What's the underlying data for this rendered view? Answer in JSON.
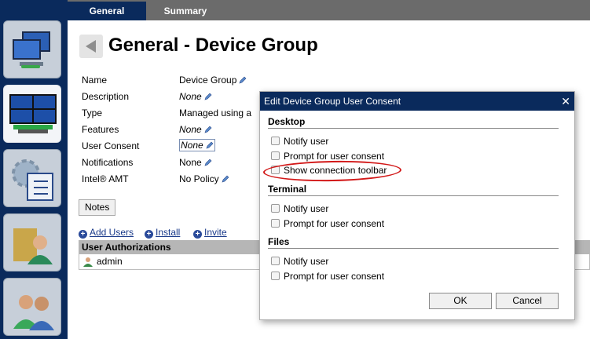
{
  "sidebar": {
    "items": [
      {
        "icon": "computers-icon"
      },
      {
        "icon": "device-group-icon"
      },
      {
        "icon": "settings-checklist-icon"
      },
      {
        "icon": "user-folder-icon"
      },
      {
        "icon": "users-icon"
      }
    ]
  },
  "tabs": [
    {
      "label": "General"
    },
    {
      "label": "Summary"
    }
  ],
  "page": {
    "title": "General - Device Group",
    "properties": [
      {
        "label": "Name",
        "value": "Device Group"
      },
      {
        "label": "Description",
        "value": "None"
      },
      {
        "label": "Type",
        "value": "Managed using a"
      },
      {
        "label": "Features",
        "value": "None"
      },
      {
        "label": "User Consent",
        "value": "None"
      },
      {
        "label": "Notifications",
        "value": "None"
      },
      {
        "label": "Intel® AMT",
        "value": "No Policy"
      }
    ],
    "notes_label": "Notes",
    "links": {
      "add_users": "Add Users",
      "install": "Install",
      "invite": "Invite"
    },
    "auth_header": "User Authorizations",
    "auth_rows": [
      {
        "name": "admin"
      }
    ]
  },
  "dialog": {
    "title": "Edit Device Group User Consent",
    "close": "✕",
    "sections": [
      {
        "heading": "Desktop",
        "options": [
          "Notify user",
          "Prompt for user consent",
          "Show connection toolbar"
        ]
      },
      {
        "heading": "Terminal",
        "options": [
          "Notify user",
          "Prompt for user consent"
        ]
      },
      {
        "heading": "Files",
        "options": [
          "Notify user",
          "Prompt for user consent"
        ]
      }
    ],
    "ok_label": "OK",
    "cancel_label": "Cancel"
  },
  "colors": {
    "brand_navy": "#0a2a5c",
    "tab_bar": "#6b6b6b",
    "annotation_red": "#d21818"
  }
}
